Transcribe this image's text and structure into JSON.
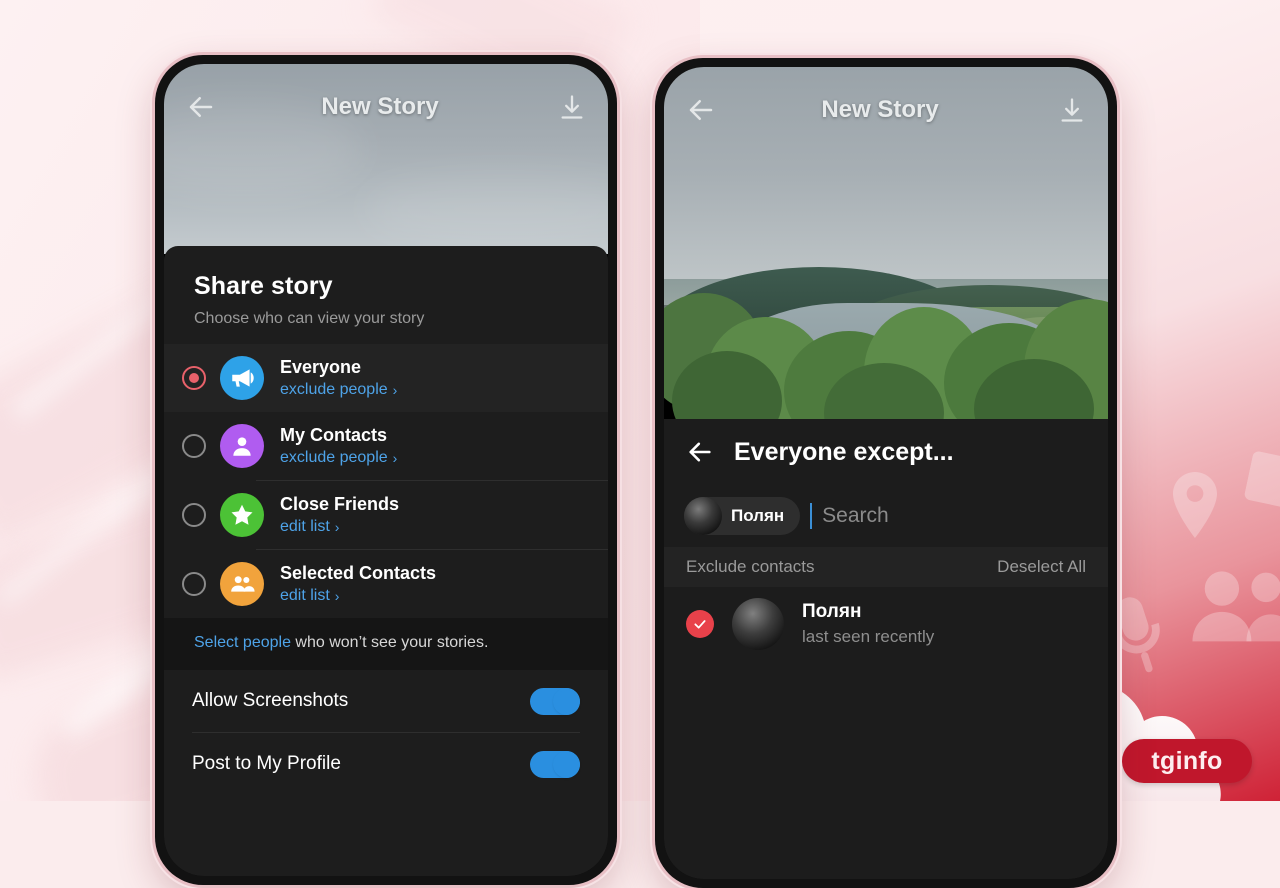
{
  "brand": {
    "logo_text": "tginfo",
    "badge_color": "#c0172c"
  },
  "phone_left": {
    "topbar": {
      "back_icon": "arrow-left-icon",
      "title": "New Story",
      "download_icon": "download-icon"
    },
    "sheet": {
      "title": "Share story",
      "subtitle": "Choose who can view your story",
      "options": [
        {
          "name": "Everyone",
          "link": "exclude people",
          "chevron": "›",
          "selected": true,
          "icon": "megaphone-icon",
          "color": "#2ea2e8"
        },
        {
          "name": "My Contacts",
          "link": "exclude people",
          "chevron": "›",
          "selected": false,
          "icon": "person-icon",
          "color": "#b05cf0"
        },
        {
          "name": "Close Friends",
          "link": "edit list",
          "chevron": "›",
          "selected": false,
          "icon": "star-icon",
          "color": "#4cc236"
        },
        {
          "name": "Selected Contacts",
          "link": "edit list",
          "chevron": "›",
          "selected": false,
          "icon": "people-icon",
          "color": "#f1a33c"
        }
      ],
      "hint_link": "Select people",
      "hint_rest": " who won’t see your stories.",
      "toggles": [
        {
          "label": "Allow Screenshots",
          "on": true
        },
        {
          "label": "Post to My Profile",
          "on": true
        }
      ]
    }
  },
  "phone_right": {
    "topbar": {
      "back_icon": "arrow-left-icon",
      "title": "New Story",
      "download_icon": "download-icon"
    },
    "header": {
      "back_icon": "arrow-left-icon",
      "title": "Everyone except..."
    },
    "search": {
      "chip_label": "Полян",
      "placeholder": "Search",
      "value": ""
    },
    "section": {
      "label": "Exclude contacts",
      "action": "Deselect All"
    },
    "contacts": [
      {
        "name": "Полян",
        "status": "last seen recently",
        "checked": true
      }
    ]
  },
  "colors": {
    "accent_blue": "#4ea3e8",
    "accent_red": "#e8414a",
    "toggle_blue": "#2a8fe0",
    "sheet_bg": "#1d1d1d"
  }
}
